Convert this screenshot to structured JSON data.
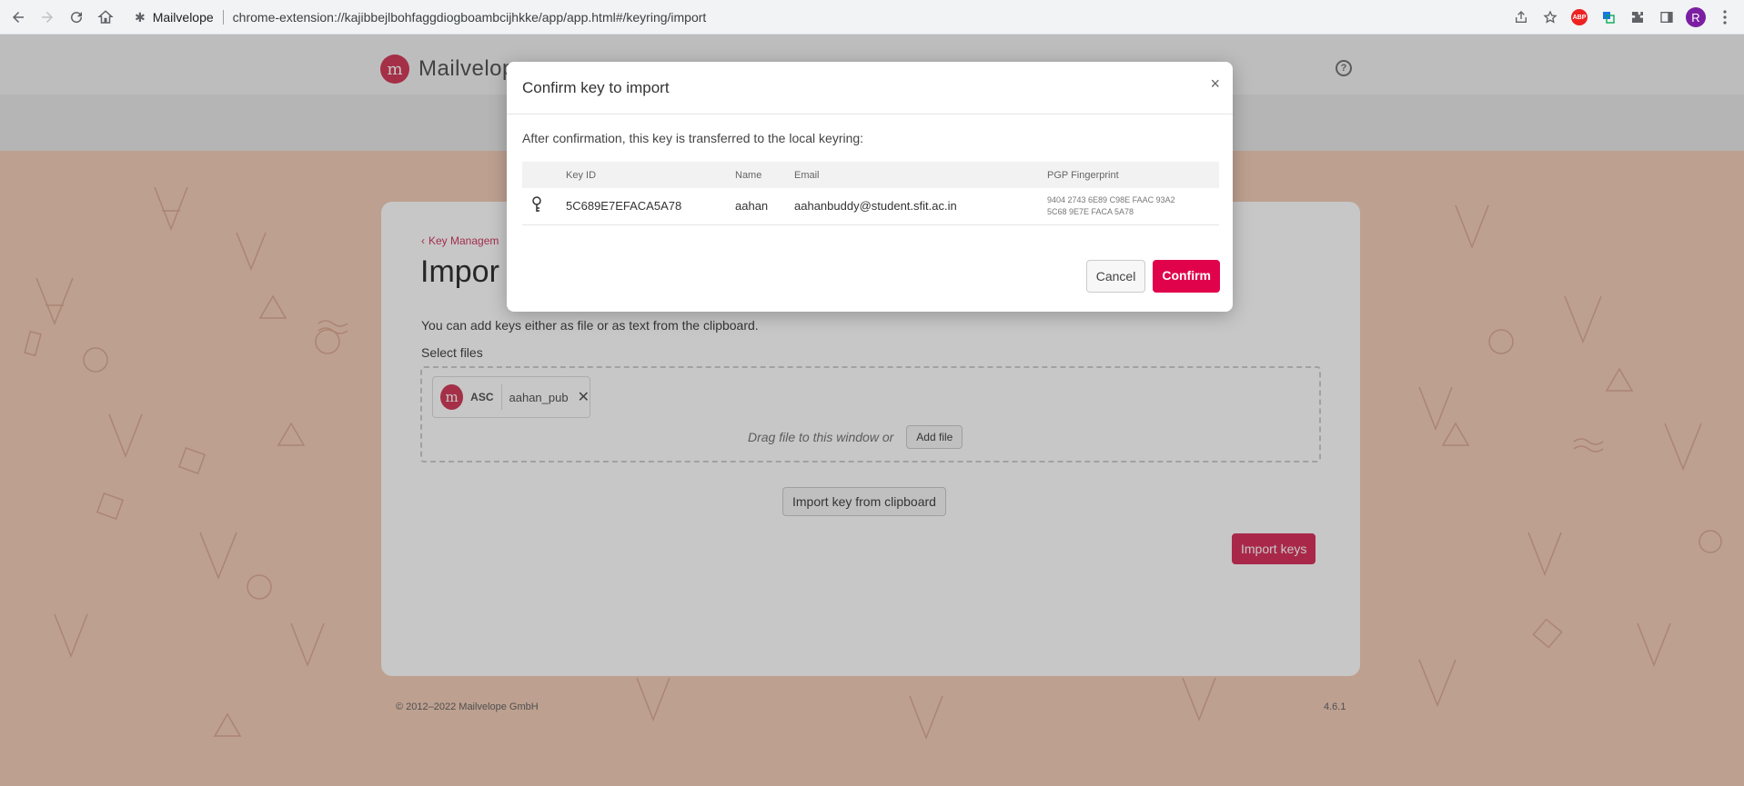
{
  "browser": {
    "site_name": "Mailvelope",
    "url": "chrome-extension://kajibbejlbohfaggdiogboambcijhkke/app/app.html#/keyring/import",
    "profile_initial": "R",
    "abp_label": "ABP"
  },
  "app": {
    "brand": "Mailvelope",
    "logo_letter": "m",
    "help_icon": "?",
    "back_link": "Key Managem",
    "page_title": "Impor",
    "intro_text": "You can add keys either as file or as text from the clipboard.",
    "select_files_label": "Select files",
    "file_chip": {
      "type": "ASC",
      "name": "aahan_pub",
      "close": "✕"
    },
    "drag_text": "Drag file to this window or",
    "add_file_label": "Add file",
    "clipboard_label": "Import key from clipboard",
    "import_keys_label": "Import keys",
    "footer_copyright": "© 2012–2022  Mailvelope GmbH",
    "footer_version": "4.6.1"
  },
  "modal": {
    "title": "Confirm key to import",
    "close": "×",
    "description": "After confirmation, this key is transferred to the local keyring:",
    "columns": {
      "key_id": "Key ID",
      "name": "Name",
      "email": "Email",
      "fingerprint": "PGP Fingerprint"
    },
    "row": {
      "key_id": "5C689E7EFACA5A78",
      "name": "aahan",
      "email": "aahanbuddy@student.sfit.ac.in",
      "fingerprint_line1": "9404 2743 6E89 C98E FAAC 93A2",
      "fingerprint_line2": "5C68 9E7E FACA 5A78"
    },
    "cancel_label": "Cancel",
    "confirm_label": "Confirm"
  },
  "colors": {
    "brand": "#d33d5b",
    "confirm": "#e0034b",
    "background": "#f3cdb9"
  }
}
